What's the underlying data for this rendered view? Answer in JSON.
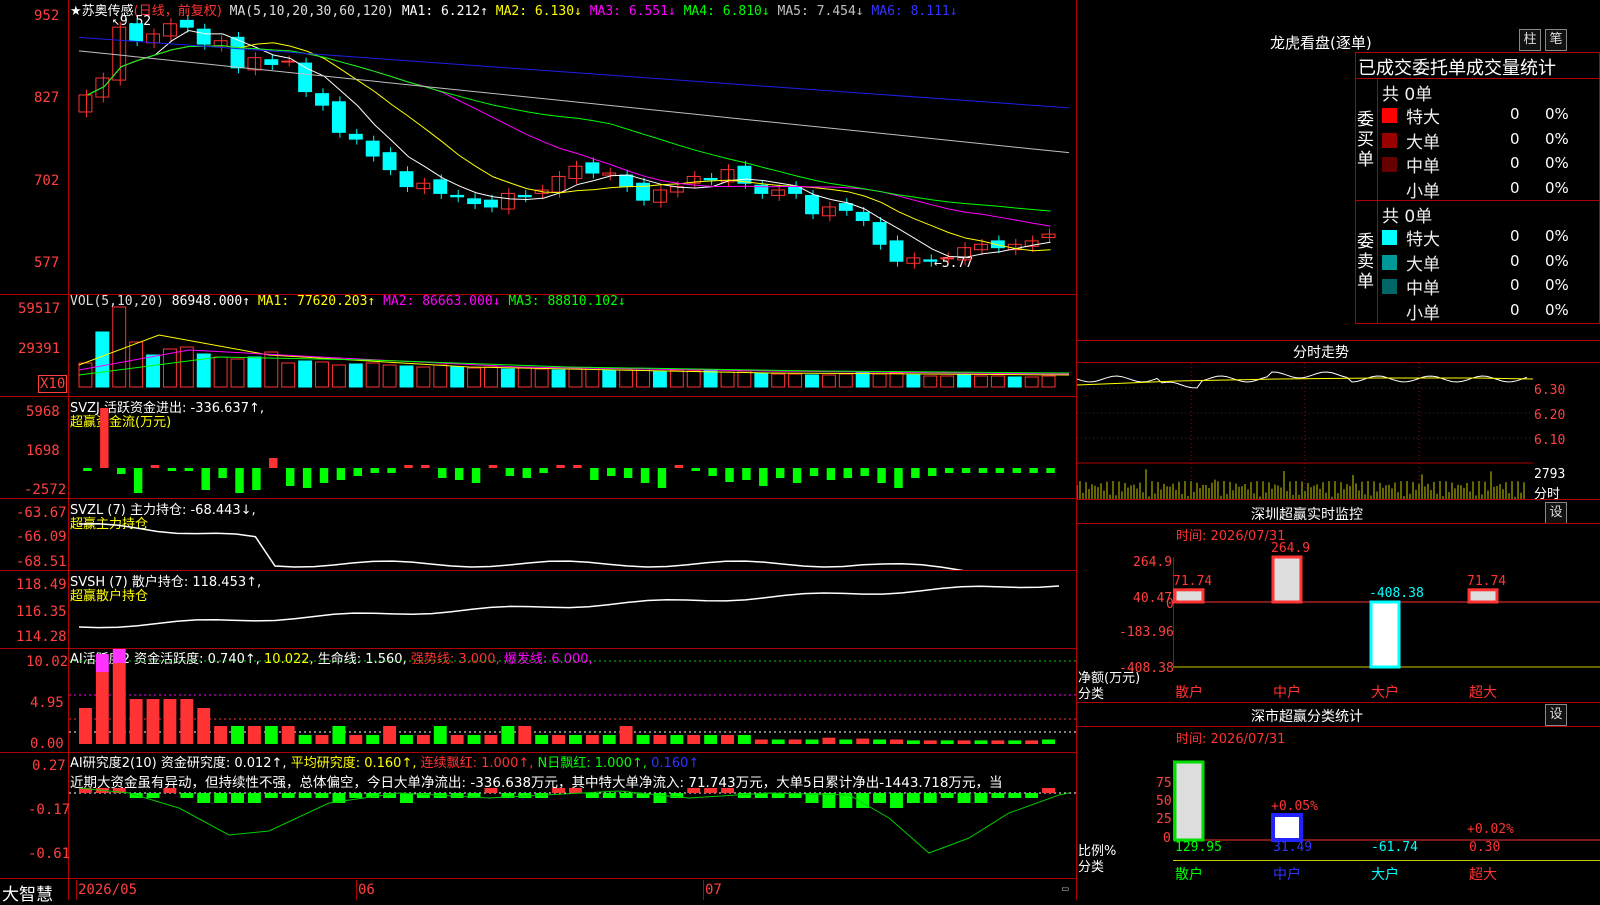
{
  "colors": {
    "up": "#ff3333",
    "down": "#00ffff",
    "ma1": "#ffffff",
    "ma2": "#ffff00",
    "ma3": "#ff00ff",
    "ma4": "#00ff00",
    "ma5": "#c0c0c0",
    "ma6": "#1e1ee6",
    "grid": "#b00000",
    "axis": "#ff4040"
  },
  "header": {
    "stock": "★苏奥传感",
    "mode": "(日线，前复权)",
    "ma_label": "MA(5,10,20,30,60,120)",
    "ma1": "MA1: 6.212↑",
    "ma2": "MA2: 6.130↓",
    "ma3": "MA3: 6.551↓",
    "ma4": "MA4: 6.810↓",
    "ma5": "MA5: 7.454↓",
    "ma6": "MA6: 8.111↓"
  },
  "price_axis": [
    "952",
    "827",
    "702",
    "577"
  ],
  "price_high_label": "9.52",
  "price_low_label": "5.77",
  "vol": {
    "title": "VOL(5,10,20)",
    "v": "86948.000↑",
    "ma1": "MA1: 77620.203↑",
    "ma2": "MA2: 86663.000↓",
    "ma3": "MA3: 88810.102↓",
    "axis": [
      "59517",
      "29391"
    ],
    "unit": "X10"
  },
  "svzj": {
    "title": "SVZJ  活跃资金进出: -336.637↑,",
    "sub": "超赢资金流(万元)",
    "axis": [
      "5968",
      "1698",
      "-2572"
    ]
  },
  "svzl": {
    "title": "SVZL (7) 主力持仓: -68.443↓,",
    "sub": "超赢主力持仓",
    "axis": [
      "-63.67",
      "-66.09",
      "-68.51"
    ]
  },
  "svsh": {
    "title": "SVSH (7) 散户持仓: 118.453↑,",
    "sub": "超赢散户持仓",
    "axis": [
      "118.49",
      "116.35",
      "114.28"
    ]
  },
  "ai1": {
    "title": "AI活跃度2 资金活跃度: 0.740↑,",
    "t2": "10.022,",
    "t3": "生命线: 1.560,",
    "t4": "强势线: 3.000,",
    "t5": "爆发线: 6.000,",
    "axis": [
      "10.02",
      "4.95",
      "0.00"
    ]
  },
  "ai2": {
    "title": "AI研究度2(10) 资金研究度: 0.012↑,",
    "t2": "平均研究度: 0.160↑,",
    "t3": "连续飘红: 1.000↑,",
    "t4": "N日飘红: 1.000↑,",
    "t5": "0.160↑",
    "axis": [
      "0.27",
      "-0.17",
      "-0.61"
    ],
    "comment": "近期大资金虽有异动，但持续性不强，总体偏空，今日大单净流出: -336.638万元，其中特大单净流入: 71.743万元，大单5日累计净出-1443.718万元，当"
  },
  "date_axis": [
    "2026/05",
    "06",
    "07"
  ],
  "brand": "大智慧",
  "side": {
    "title": "龙虎看盘(逐单)",
    "btn1": "柱",
    "btn2": "笔",
    "heading": "已成交委托单成交量统计",
    "buy": {
      "label": "委买单",
      "total": "共 0单",
      "rows": [
        {
          "name": "特大",
          "count": "0",
          "pct": "0%",
          "color": "#ff0000"
        },
        {
          "name": "大单",
          "count": "0",
          "pct": "0%",
          "color": "#990000"
        },
        {
          "name": "中单",
          "count": "0",
          "pct": "0%",
          "color": "#660000"
        },
        {
          "name": "小单",
          "count": "0",
          "pct": "0%",
          "color": "#000000"
        }
      ]
    },
    "sell": {
      "label": "委卖单",
      "total": "共 0单",
      "rows": [
        {
          "name": "特大",
          "count": "0",
          "pct": "0%",
          "color": "#00ffff"
        },
        {
          "name": "大单",
          "count": "0",
          "pct": "0%",
          "color": "#009999"
        },
        {
          "name": "中单",
          "count": "0",
          "pct": "0%",
          "color": "#006666"
        },
        {
          "name": "小单",
          "count": "0",
          "pct": "0%",
          "color": "#000000"
        }
      ]
    },
    "intraday": {
      "title": "分时走势",
      "axis": [
        "6.30",
        "6.20",
        "6.10"
      ],
      "vol": "2793",
      "vol_label": "分时"
    },
    "monitor": {
      "title": "深圳超赢实时监控",
      "btn": "设",
      "time": "时间: 2026/07/31",
      "axis": [
        "264.9",
        "40.47",
        "0",
        "-183.96",
        "-408.38"
      ],
      "y_title": "净额(万元)",
      "x_title": "分类",
      "categories": [
        "散户",
        "中户",
        "大户",
        "超大"
      ],
      "values": [
        71.74,
        264.9,
        -408.38,
        71.74
      ],
      "value_labels": [
        "71.74",
        "264.9",
        "-408.38",
        "71.74"
      ]
    },
    "classify": {
      "title": "深市超赢分类统计",
      "btn": "设",
      "time": "时间: 2026/07/31",
      "axis": [
        "75",
        "50",
        "25",
        "0"
      ],
      "y_title": "比例%",
      "x_title": "分类",
      "categories": [
        "散户",
        "中户",
        "大户",
        "超大"
      ],
      "values": [
        "129.95",
        "31.49",
        "-61.74",
        "0.30"
      ],
      "pct": [
        "",
        "+0.05%",
        "",
        "+0.02%"
      ]
    }
  }
}
